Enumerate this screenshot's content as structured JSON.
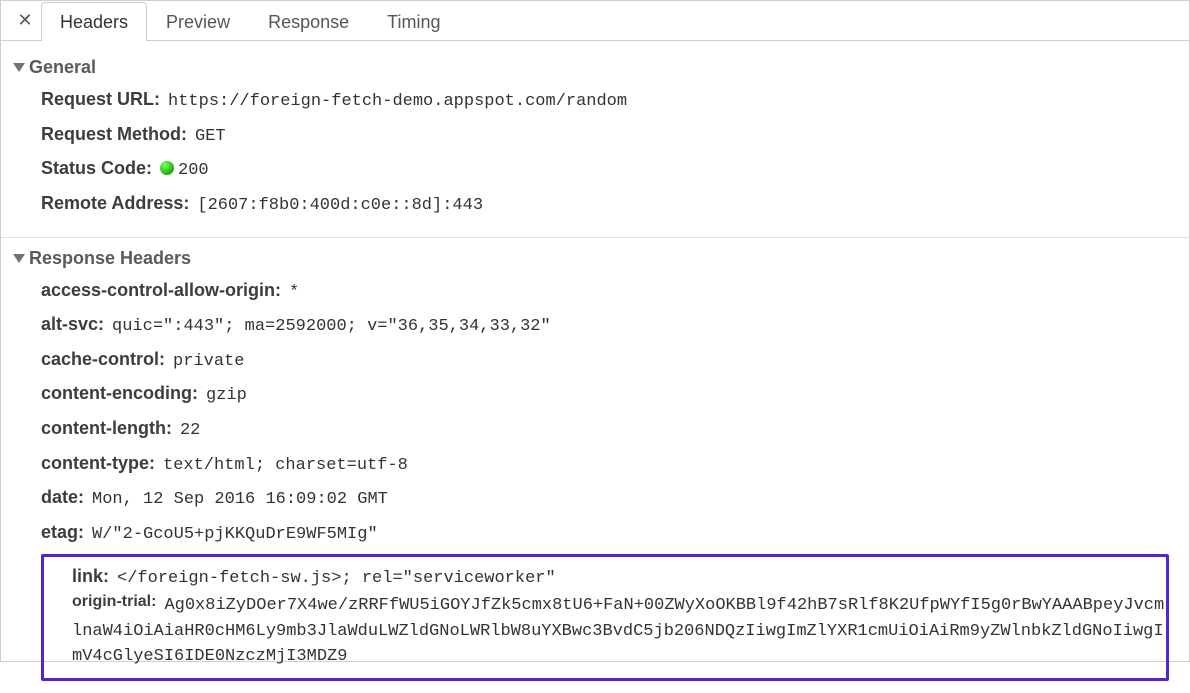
{
  "tabs": {
    "headers": "Headers",
    "preview": "Preview",
    "response": "Response",
    "timing": "Timing"
  },
  "general": {
    "title": "General",
    "request_url_label": "Request URL:",
    "request_url_value": "https://foreign-fetch-demo.appspot.com/random",
    "request_method_label": "Request Method:",
    "request_method_value": "GET",
    "status_code_label": "Status Code:",
    "status_code_value": "200",
    "remote_address_label": "Remote Address:",
    "remote_address_value": "[2607:f8b0:400d:c0e::8d]:443"
  },
  "response_headers": {
    "title": "Response Headers",
    "items": [
      {
        "label": "access-control-allow-origin:",
        "value": "*"
      },
      {
        "label": "alt-svc:",
        "value": "quic=\":443\"; ma=2592000; v=\"36,35,34,33,32\""
      },
      {
        "label": "cache-control:",
        "value": "private"
      },
      {
        "label": "content-encoding:",
        "value": "gzip"
      },
      {
        "label": "content-length:",
        "value": "22"
      },
      {
        "label": "content-type:",
        "value": "text/html; charset=utf-8"
      },
      {
        "label": "date:",
        "value": "Mon, 12 Sep 2016 16:09:02 GMT"
      },
      {
        "label": "etag:",
        "value": "W/\"2-GcoU5+pjKKQuDrE9WF5MIg\""
      }
    ],
    "highlighted": {
      "link_label": "link:",
      "link_value": "</foreign-fetch-sw.js>; rel=\"serviceworker\"",
      "origin_trial_label": "origin-trial:",
      "origin_trial_value": "Ag0x8iZyDOer7X4we/zRRFfWU5iGOYJfZk5cmx8tU6+FaN+00ZWyXoOKBBl9f42hB7sRlf8K2UfpWYfI5g0rBwYAAABpeyJvcmlnaW4iOiAiaHR0cHM6Ly9mb3JlaWduLWZldGNoLWRlbW8uYXBwc3BvdC5jb206NDQzIiwgImZlYXR1cmUiOiAiRm9yZWlnbkZldGNoIiwgImV4cGlyeSI6IDE0NzczMjI3MDZ9"
    }
  }
}
